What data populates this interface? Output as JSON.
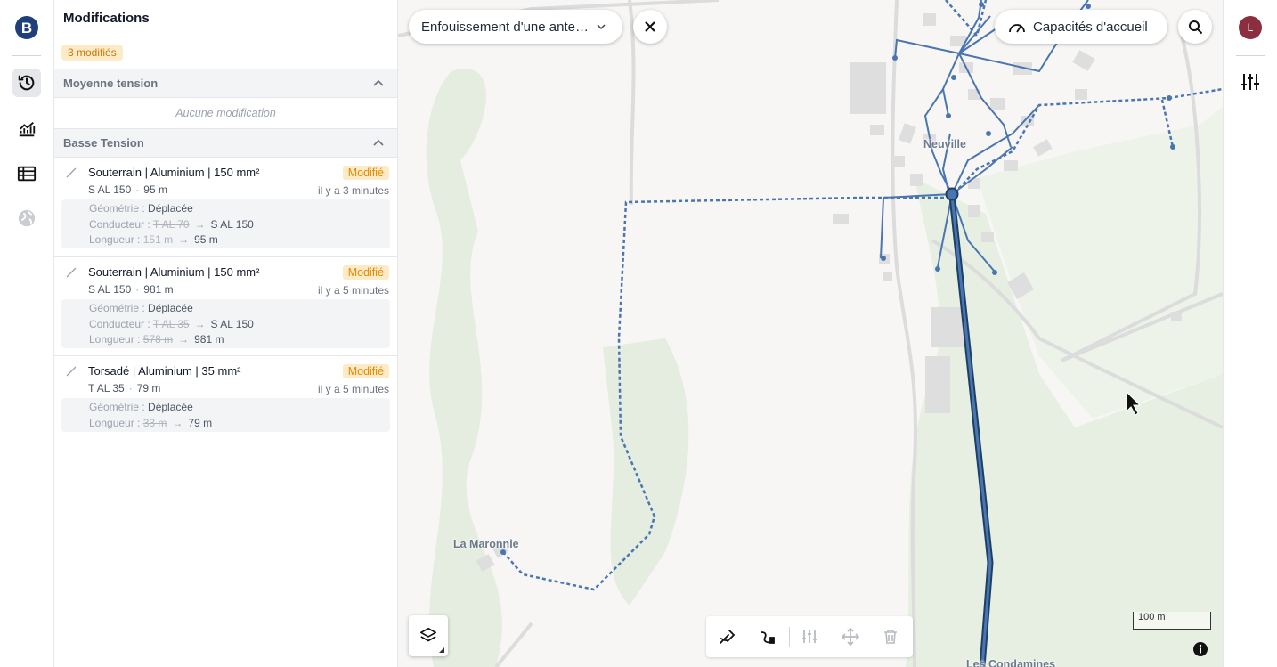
{
  "user": {
    "avatar_letter": "L"
  },
  "panel": {
    "title": "Modifications",
    "count_badge": "3 modifiés",
    "sections": [
      {
        "title": "Moyenne tension",
        "empty_text": "Aucune modification"
      },
      {
        "title": "Basse Tension"
      }
    ],
    "items": [
      {
        "title": "Souterrain | Aluminium | 150 mm²",
        "status": "Modifié",
        "code": "S AL 150",
        "length": "95 m",
        "time": "il y a 3 minutes",
        "geometry_label": "Géométrie :",
        "geometry_value": "Déplacée",
        "conductor_label": "Conducteur :",
        "conductor_old": "T AL 70",
        "conductor_new": "S AL 150",
        "length_label": "Longueur :",
        "length_old": "151 m",
        "length_new": "95 m"
      },
      {
        "title": "Souterrain | Aluminium | 150 mm²",
        "status": "Modifié",
        "code": "S AL 150",
        "length": "981 m",
        "time": "il y a 5 minutes",
        "geometry_label": "Géométrie :",
        "geometry_value": "Déplacée",
        "conductor_label": "Conducteur :",
        "conductor_old": "T AL 35",
        "conductor_new": "S AL 150",
        "length_label": "Longueur :",
        "length_old": "578 m",
        "length_new": "981 m"
      },
      {
        "title": "Torsadé | Aluminium | 35 mm²",
        "status": "Modifié",
        "code": "T AL 35",
        "length": "79 m",
        "time": "il y a 5 minutes",
        "geometry_label": "Géométrie :",
        "geometry_value": "Déplacée",
        "length_label": "Longueur :",
        "length_old": "33 m",
        "length_new": "79 m"
      }
    ]
  },
  "map": {
    "project_select": "Enfouissement d'une ante…",
    "capacity_button": "Capacités d'accueil",
    "places": [
      "Neuville",
      "La Maronnie",
      "Les Condamines"
    ],
    "scale_label": "100 m",
    "colors": {
      "network": "#3f6fa8",
      "selected": "#1e3f66",
      "accent": "#e08a00"
    }
  },
  "icons": {
    "rail": [
      "logo-icon",
      "history-icon",
      "chart-icon",
      "table-icon",
      "globe-icon"
    ],
    "toolbar": [
      "draw-line-icon",
      "connect-icon",
      "adjust-icon",
      "move-icon",
      "trash-icon"
    ]
  }
}
